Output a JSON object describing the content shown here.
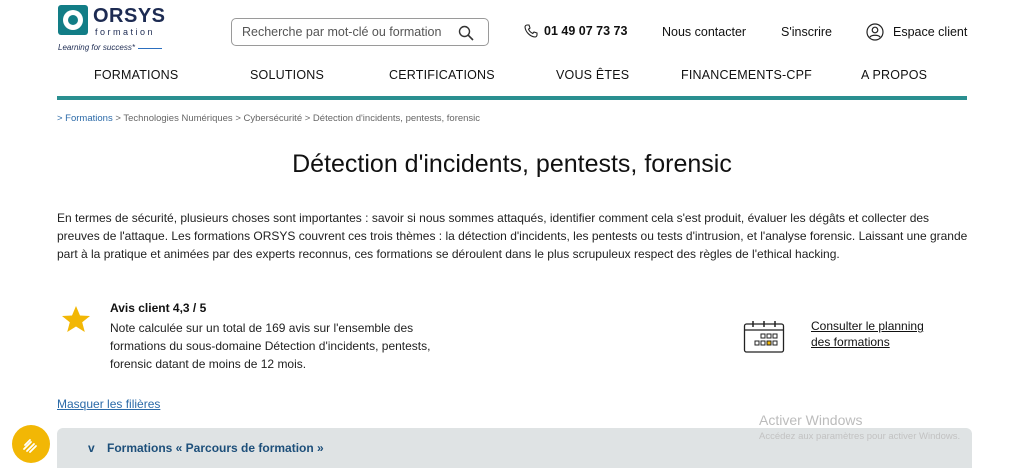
{
  "logo": {
    "name": "ORSYS",
    "sub": "formation",
    "tagline": "Learning for success*"
  },
  "search": {
    "placeholder": "Recherche par mot-clé ou formation",
    "icon": "search-icon"
  },
  "header": {
    "phone": "01 49 07 73 73",
    "contact": "Nous contacter",
    "signup": "S'inscrire",
    "client_space": "Espace client"
  },
  "nav": {
    "items": [
      {
        "label": "FORMATIONS"
      },
      {
        "label": "SOLUTIONS"
      },
      {
        "label": "CERTIFICATIONS"
      },
      {
        "label": "VOUS ÊTES"
      },
      {
        "label": "FINANCEMENTS-CPF"
      },
      {
        "label": "A PROPOS"
      }
    ]
  },
  "breadcrumb": {
    "items": [
      {
        "label": "> Formations"
      },
      {
        "label": "> Technologies Numériques"
      },
      {
        "label": "> Cybersécurité"
      },
      {
        "label": "> Détection d'incidents, pentests, forensic"
      }
    ]
  },
  "page": {
    "title": "Détection d'incidents, pentests, forensic",
    "intro": "En termes de sécurité, plusieurs choses sont importantes : savoir si nous sommes attaqués, identifier comment cela s'est produit, évaluer les dégâts et collecter des preuves de l'attaque. Les formations ORSYS couvrent ces trois thèmes : la détection d'incidents, les pentests ou tests d'intrusion, et l'analyse forensic. Laissant une grande part à la pratique et animées par des experts reconnus, ces formations se déroulent dans le plus scrupuleux respect des règles de l'ethical hacking."
  },
  "rating": {
    "title": "Avis client 4,3 / 5",
    "note": "Note calculée sur un total de 169 avis sur l'ensemble des formations du sous-domaine Détection d'incidents, pentests, forensic datant de moins de 12 mois."
  },
  "planning": {
    "line1": "Consulter le planning",
    "line2": "des formations"
  },
  "links": {
    "hide": "Masquer les filières"
  },
  "accordion": {
    "chevron": "v",
    "label": "Formations « Parcours de formation »"
  },
  "watermark": {
    "title": "Activer Windows",
    "sub": "Accédez aux paramètres pour activer Windows."
  },
  "colors": {
    "brand_teal": "#2a8f90",
    "brand_navy": "#1d2b52",
    "link_blue": "#2b6aa8",
    "star_yellow": "#f2b705"
  }
}
